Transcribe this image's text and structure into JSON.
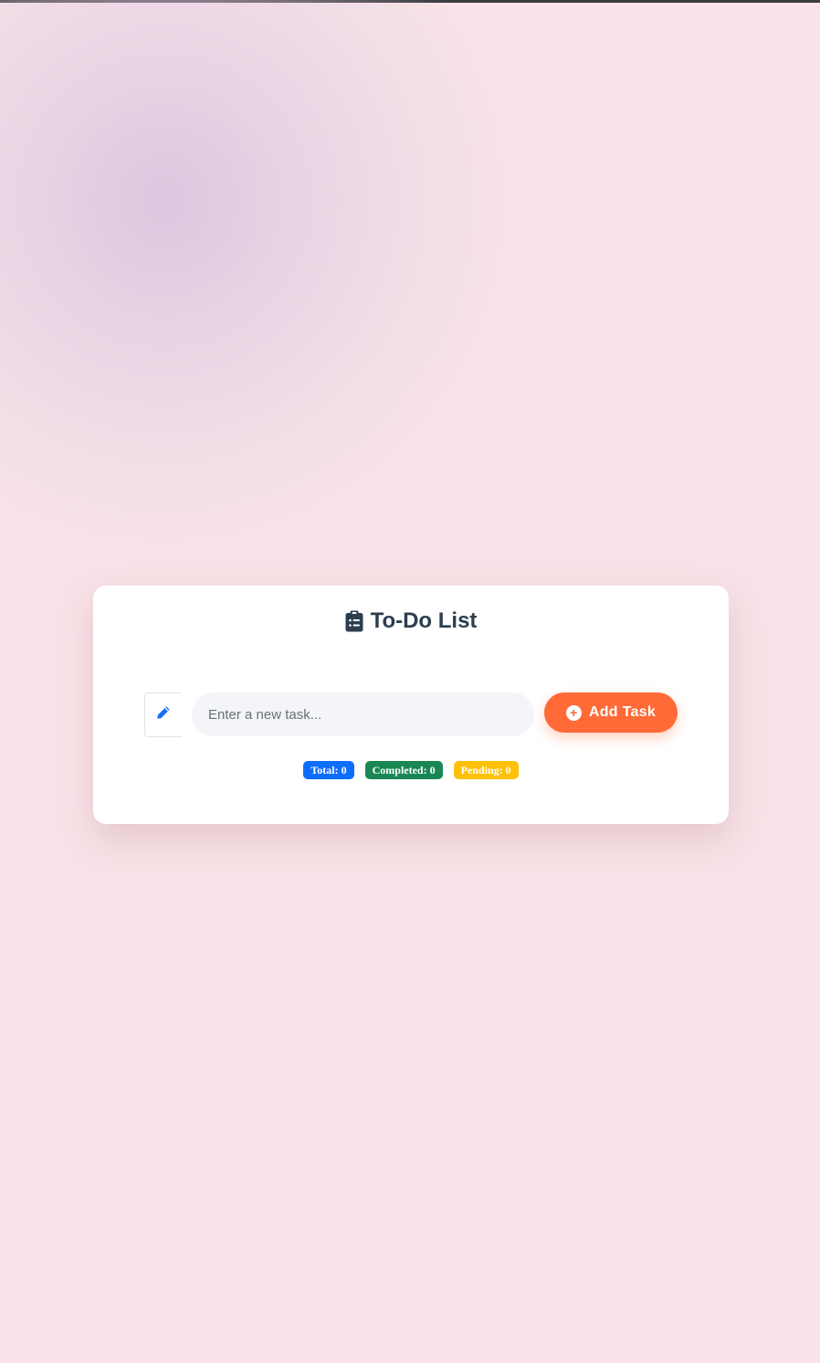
{
  "app": {
    "title": "To-Do List",
    "title_icon": "clipboard-list-icon"
  },
  "input": {
    "icon": "pencil-icon",
    "placeholder": "Enter a new task...",
    "value": ""
  },
  "add_button": {
    "label": "Add Task",
    "icon": "plus-circle-icon"
  },
  "stats": {
    "total": "Total: 0",
    "completed": "Completed: 0",
    "pending": "Pending: 0"
  },
  "colors": {
    "page_background": "#f9e3e8",
    "accent": "#ff6a36",
    "title": "#2c3e50",
    "pencil": "#1a6ef5",
    "total_badge": "#0d6efd",
    "completed_badge": "#198754",
    "pending_badge": "#ffc107"
  }
}
